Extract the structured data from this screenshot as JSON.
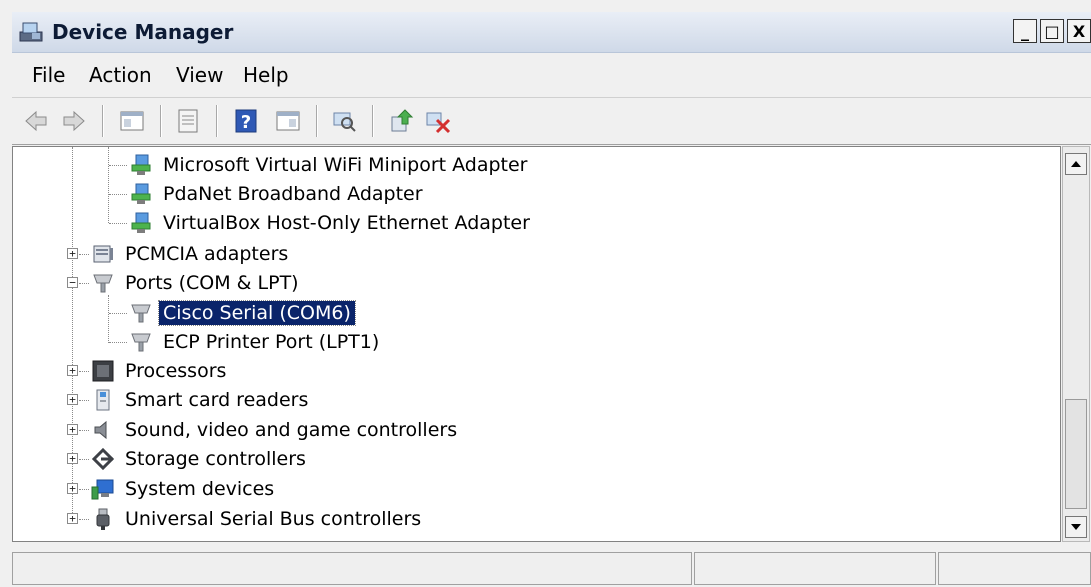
{
  "window": {
    "title": "Device Manager",
    "controls": {
      "minimize": "_",
      "maximize": "□",
      "close": "X"
    }
  },
  "menu": {
    "items": [
      {
        "label": "File",
        "icon": null
      },
      {
        "label": "Action"
      },
      {
        "label": "View"
      },
      {
        "label": "Help"
      }
    ]
  },
  "toolbar": {
    "buttons": [
      {
        "icon": "back-arrow-icon"
      },
      {
        "icon": "forward-arrow-icon"
      },
      {
        "icon": "show-hide-console-tree-icon"
      },
      {
        "icon": "properties-icon"
      },
      {
        "icon": "help-icon"
      },
      {
        "icon": "action-pane-icon"
      },
      {
        "icon": "scan-hardware-icon"
      },
      {
        "icon": "update-driver-icon"
      },
      {
        "icon": "uninstall-icon"
      }
    ]
  },
  "tree": {
    "items": [
      {
        "label": "Microsoft Virtual WiFi Miniport Adapter",
        "icon": "network-adapter-icon",
        "level": 2
      },
      {
        "label": "PdaNet Broadband Adapter",
        "icon": "network-adapter-icon",
        "level": 2
      },
      {
        "label": "VirtualBox Host-Only Ethernet Adapter",
        "icon": "network-adapter-icon",
        "level": 2
      },
      {
        "label": "PCMCIA adapters",
        "icon": "pcmcia-icon",
        "level": 1,
        "expander": "+"
      },
      {
        "label": "Ports (COM & LPT)",
        "icon": "port-icon",
        "level": 1,
        "expander": "−"
      },
      {
        "label": "Cisco Serial (COM6)",
        "icon": "port-icon",
        "level": 2,
        "selected": true
      },
      {
        "label": "ECP Printer Port (LPT1)",
        "icon": "port-icon",
        "level": 2
      },
      {
        "label": "Processors",
        "icon": "processor-icon",
        "level": 1,
        "expander": "+"
      },
      {
        "label": "Smart card readers",
        "icon": "smart-card-icon",
        "level": 1,
        "expander": "+"
      },
      {
        "label": "Sound, video and game controllers",
        "icon": "speaker-icon",
        "level": 1,
        "expander": "+"
      },
      {
        "label": "Storage controllers",
        "icon": "storage-icon",
        "level": 1,
        "expander": "+"
      },
      {
        "label": "System devices",
        "icon": "system-device-icon",
        "level": 1,
        "expander": "+"
      },
      {
        "label": "Universal Serial Bus controllers",
        "icon": "usb-icon",
        "level": 1,
        "expander": "+"
      }
    ]
  },
  "colors": {
    "selection": "#0a246a",
    "titlebar": "#d6deea"
  }
}
